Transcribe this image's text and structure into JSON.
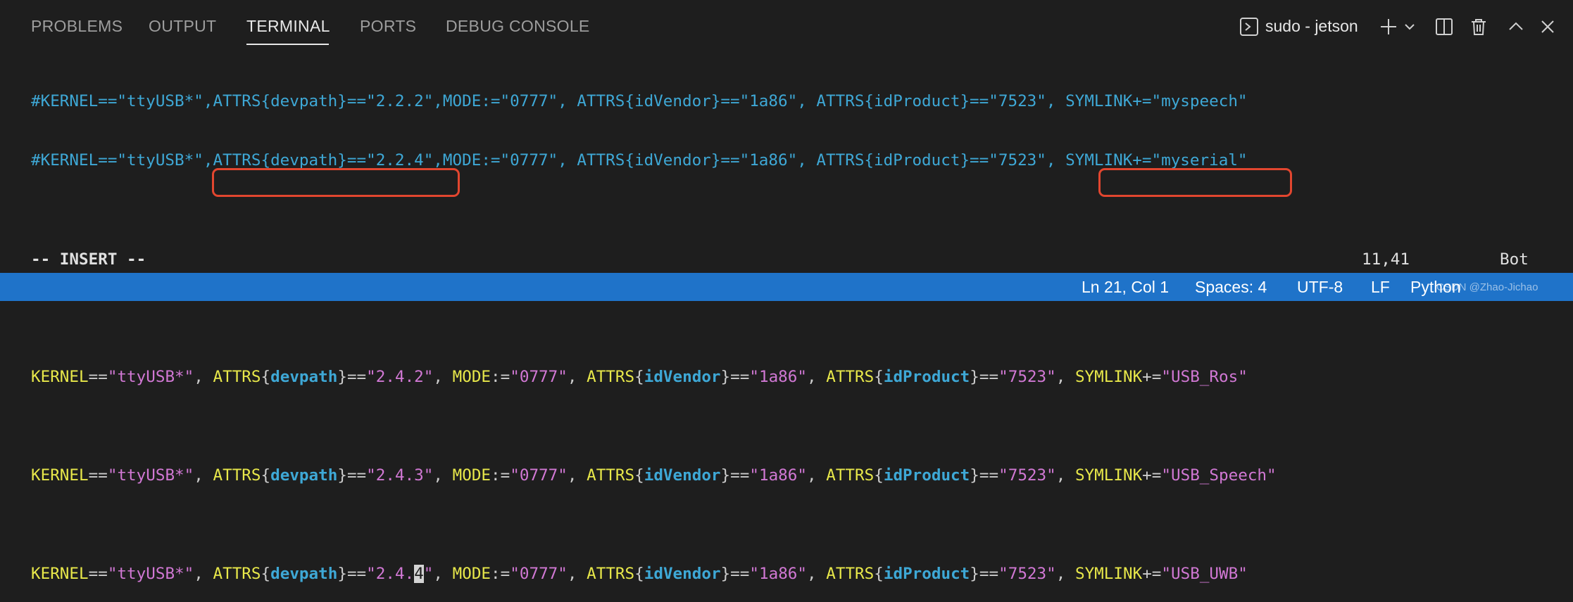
{
  "panel": {
    "tabs": [
      {
        "label": "PROBLEMS"
      },
      {
        "label": "OUTPUT"
      },
      {
        "label": "TERMINAL"
      },
      {
        "label": "PORTS"
      },
      {
        "label": "DEBUG CONSOLE"
      }
    ],
    "active_tab": "TERMINAL",
    "terminal_name": "sudo - jetson",
    "icons": [
      "terminal-icon",
      "plus-icon",
      "chevron-down-icon",
      "split-icon",
      "trash-icon",
      "chevron-up-icon",
      "close-icon"
    ]
  },
  "editor": {
    "comment_lines": [
      "#KERNEL==\"ttyUSB*\",ATTRS{devpath}==\"2.2.2\",MODE:=\"0777\", ATTRS{idVendor}==\"1a86\", ATTRS{idProduct}==\"7523\", SYMLINK+=\"myspeech\"",
      "#KERNEL==\"ttyUSB*\",ATTRS{devpath}==\"2.2.4\",MODE:=\"0777\", ATTRS{idVendor}==\"1a86\", ATTRS{idProduct}==\"7523\", SYMLINK+=\"myserial\""
    ],
    "rules": [
      {
        "kernel": "\"ttyUSB*\"",
        "devpath": "\"2.4.2\"",
        "mode": "\"0777\"",
        "vendor": "\"1a86\"",
        "product": "\"7523\"",
        "symlink": "\"USB_Ros\""
      },
      {
        "kernel": "\"ttyUSB*\"",
        "devpath": "\"2.4.3\"",
        "mode": "\"0777\"",
        "vendor": "\"1a86\"",
        "product": "\"7523\"",
        "symlink": "\"USB_Speech\""
      },
      {
        "kernel": "\"ttyUSB*\"",
        "devpath_pre": "\"2.4.",
        "devpath_cursor": "4",
        "devpath_post": "\"",
        "mode": "\"0777\"",
        "vendor": "\"1a86\"",
        "product": "\"7523\"",
        "symlink": "\"USB_UWB\""
      }
    ],
    "tokens": {
      "kernel": "KERNEL",
      "attrs": "ATTRS",
      "devpath": "devpath",
      "mode": "MODE",
      "idVendor": "idVendor",
      "idProduct": "idProduct",
      "symlink": "SYMLINK",
      "eq": "==",
      "assign": ":=",
      "append": "+=",
      "lbrace": "{",
      "rbrace": "}",
      "comma": ",",
      "comma_sp": ", "
    },
    "mode_text": "-- INSERT --",
    "cursor_pos": "11,41",
    "scroll_pos": "Bot"
  },
  "statusbar": {
    "line_col": "Ln 21, Col 1",
    "spaces": "Spaces: 4",
    "encoding": "UTF-8",
    "eol": "LF",
    "language": "Python",
    "watermark": "CSDN @Zhao-Jichao"
  },
  "colors": {
    "background": "#1e1e1e",
    "statusbar": "#1f73c9",
    "highlight_box": "#e2462f",
    "keyword": "#e8e84a",
    "attribute": "#3ea8d6",
    "string": "#d178d4"
  }
}
